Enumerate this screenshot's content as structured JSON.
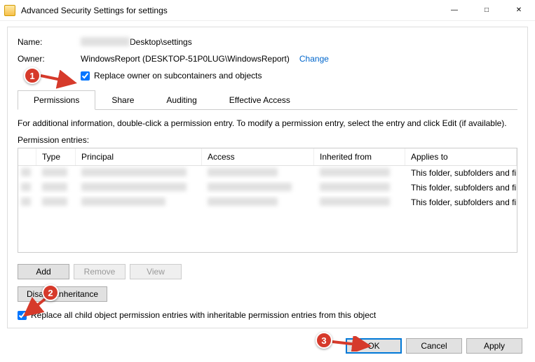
{
  "window": {
    "title": "Advanced Security Settings for settings"
  },
  "fields": {
    "name_label": "Name:",
    "name_suffix": "Desktop\\settings",
    "owner_label": "Owner:",
    "owner_value": "WindowsReport (DESKTOP-51P0LUG\\WindowsReport)",
    "change_link": "Change",
    "replace_owner_label": "Replace owner on subcontainers and objects"
  },
  "tabs": {
    "permissions": "Permissions",
    "share": "Share",
    "auditing": "Auditing",
    "effective": "Effective Access"
  },
  "permissions": {
    "info": "For additional information, double-click a permission entry. To modify a permission entry, select the entry and click Edit (if available).",
    "entries_label": "Permission entries:",
    "headers": {
      "type": "Type",
      "principal": "Principal",
      "access": "Access",
      "inherited": "Inherited from",
      "applies": "Applies to"
    },
    "rows": [
      {
        "applies": "This folder, subfolders and files"
      },
      {
        "applies": "This folder, subfolders and files"
      },
      {
        "applies": "This folder, subfolders and files"
      }
    ],
    "buttons": {
      "add": "Add",
      "remove": "Remove",
      "view": "View",
      "disable_inheritance": "Disable inheritance"
    },
    "replace_children_label": "Replace all child object permission entries with inheritable permission entries from this object"
  },
  "footer": {
    "ok": "OK",
    "cancel": "Cancel",
    "apply": "Apply"
  },
  "annotations": {
    "b1": "1",
    "b2": "2",
    "b3": "3"
  }
}
